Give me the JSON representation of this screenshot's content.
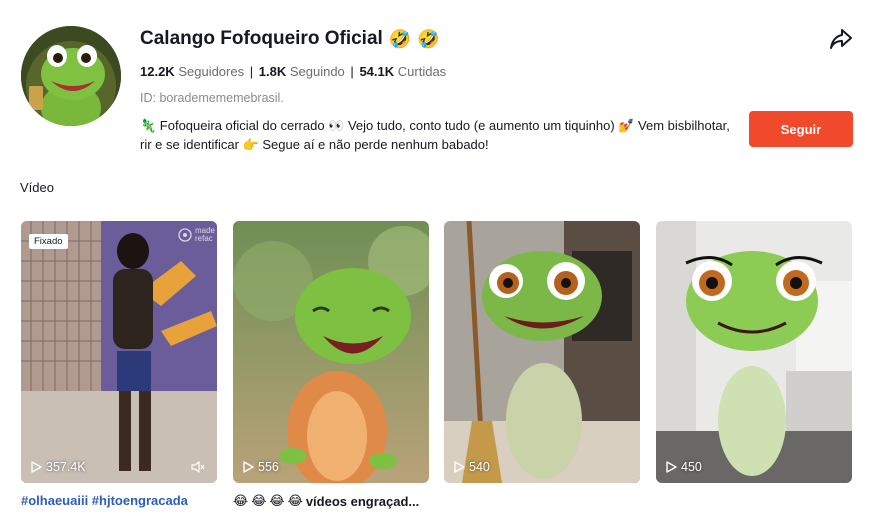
{
  "profile": {
    "display_name": "Calango Fofoqueiro Oficial",
    "name_emojis": [
      "🤣",
      "🤣"
    ],
    "stats": {
      "followers_value": "12.2K",
      "followers_label": "Seguidores",
      "following_value": "1.8K",
      "following_label": "Seguindo",
      "likes_value": "54.1K",
      "likes_label": "Curtidas",
      "separator": "|"
    },
    "user_id": "ID: borademememebrasil.",
    "bio": "🦎 Fofoqueira oficial do cerrado 👀 Vejo tudo, conto tudo (e aumento um tiquinho) 💅 Vem bisbilhotar, rir e se identificar 👉 Segue aí e não perde nenhum babado!",
    "follow_label": "Seguir",
    "share_icon": "share-arrow-icon"
  },
  "section": {
    "title": "Vídeo"
  },
  "videos": [
    {
      "views": "357.4K",
      "pinned_label": "Fixado",
      "watermark": "made\nrefac",
      "caption": "#olhaeuaiii #hjtoengracada",
      "muted": true
    },
    {
      "views": "556",
      "caption": "vídeos engraçad...",
      "caption_emojis": [
        "😂",
        "😂",
        "😂",
        "😂"
      ]
    },
    {
      "views": "540"
    },
    {
      "views": "450"
    }
  ],
  "colors": {
    "follow_button": "#f0492b",
    "hashtag": "#2b5db9",
    "muted_text": "#8a8b91"
  }
}
